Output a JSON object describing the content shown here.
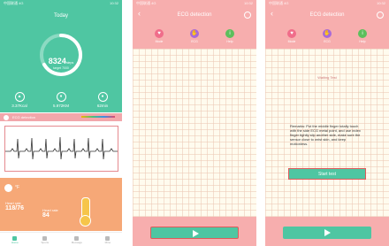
{
  "colors": {
    "teal": "#4fc6a2",
    "pink": "#f7aeae",
    "orange": "#f6a877",
    "alert_red": "#e05a5a"
  },
  "phone1": {
    "status_left": "中国联通 4G",
    "status_right": "10:32",
    "title": "Today",
    "steps_value": "8324",
    "steps_unit": "steps",
    "steps_label": "target 7000",
    "stats": [
      {
        "icon": "distance-icon",
        "value": "3.37Kcal"
      },
      {
        "icon": "calorie-icon",
        "value": "5.972KM"
      },
      {
        "icon": "time-icon",
        "value": "62min"
      }
    ],
    "ecg_header": "ECG detection",
    "temp_label": "°F",
    "bp_left_label": "Heart rate",
    "bp_left_value": "118/76",
    "bp_right_label": "Heart rate",
    "bp_right_value": "84",
    "tabs": [
      "Home",
      "Sports",
      "Message",
      "Mine"
    ]
  },
  "phone2": {
    "status_left": "中国联通 4G",
    "status_right": "10:32",
    "title": "ECG detection",
    "modes": [
      {
        "icon": "heart-icon",
        "label": "Mode",
        "color": "#f06d8a"
      },
      {
        "icon": "hand-icon",
        "label": "ECG",
        "color": "#a86ad8"
      },
      {
        "icon": "info-icon",
        "label": "Help",
        "color": "#5cbf5c"
      }
    ]
  },
  "phone3": {
    "status_left": "中国联通 4G",
    "status_right": "10:32",
    "title": "ECG detection",
    "modes": [
      {
        "icon": "heart-icon",
        "label": "Mode",
        "color": "#f06d8a"
      },
      {
        "icon": "hand-icon",
        "label": "ECG",
        "color": "#a86ad8"
      },
      {
        "icon": "info-icon",
        "label": "Help",
        "color": "#5cbf5c"
      }
    ],
    "waiting_text": "Waiting Test",
    "remark": "Remarks: Put the middle finger totally touch with the side ECG metal point, and use index finger tightly slip another side, make sure the sensor close to wrist skin, and keep motionless.",
    "start_button": "Start test"
  }
}
